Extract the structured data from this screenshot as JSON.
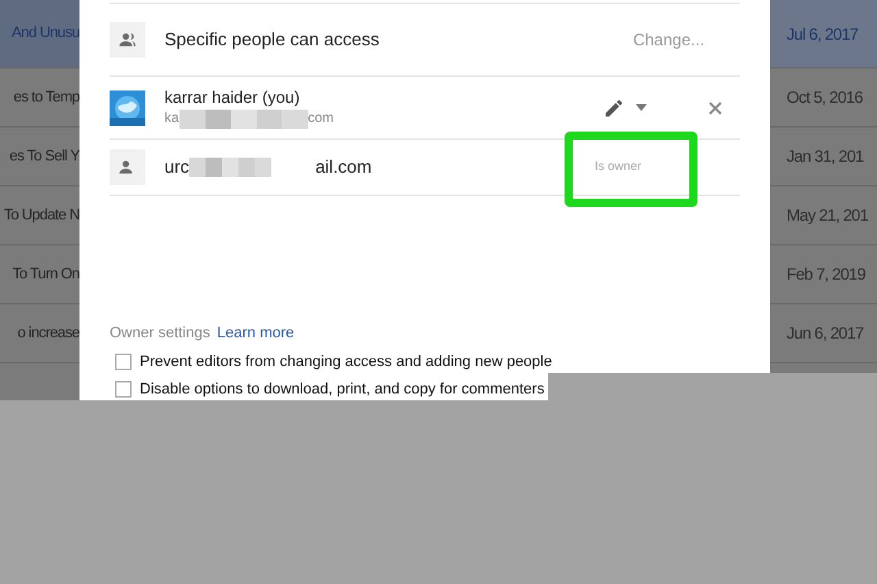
{
  "background_list": {
    "rows": [
      {
        "title": "And Unusu",
        "date": "Jul 6, 2017",
        "selected": true
      },
      {
        "title": "es to Temp",
        "date": "Oct 5, 2016",
        "selected": false
      },
      {
        "title": "es To Sell Y",
        "date": "Jan 31, 201",
        "selected": false
      },
      {
        "title": "To Update N",
        "date": "May 21, 201",
        "selected": false
      },
      {
        "title": "To Turn On",
        "date": "Feb 7, 2019",
        "selected": false
      },
      {
        "title": "o increase",
        "date": "Jun 6, 2017",
        "selected": false
      }
    ]
  },
  "dialog": {
    "access": {
      "label": "Specific people can access",
      "action": "Change..."
    },
    "people": [
      {
        "kind": "you",
        "name": "karrar haider (you)",
        "email_start": "ka",
        "email_end": "com"
      },
      {
        "kind": "owner",
        "email_start": "urc",
        "email_end": "ail.com",
        "role": "Is owner",
        "highlighted": true
      }
    ],
    "owner_settings": {
      "label": "Owner settings",
      "link": "Learn more",
      "options": [
        {
          "label": "Prevent editors from changing access and adding new people",
          "checked": false
        },
        {
          "label": "Disable options to download, print, and copy for commenters",
          "checked": false
        }
      ]
    }
  }
}
